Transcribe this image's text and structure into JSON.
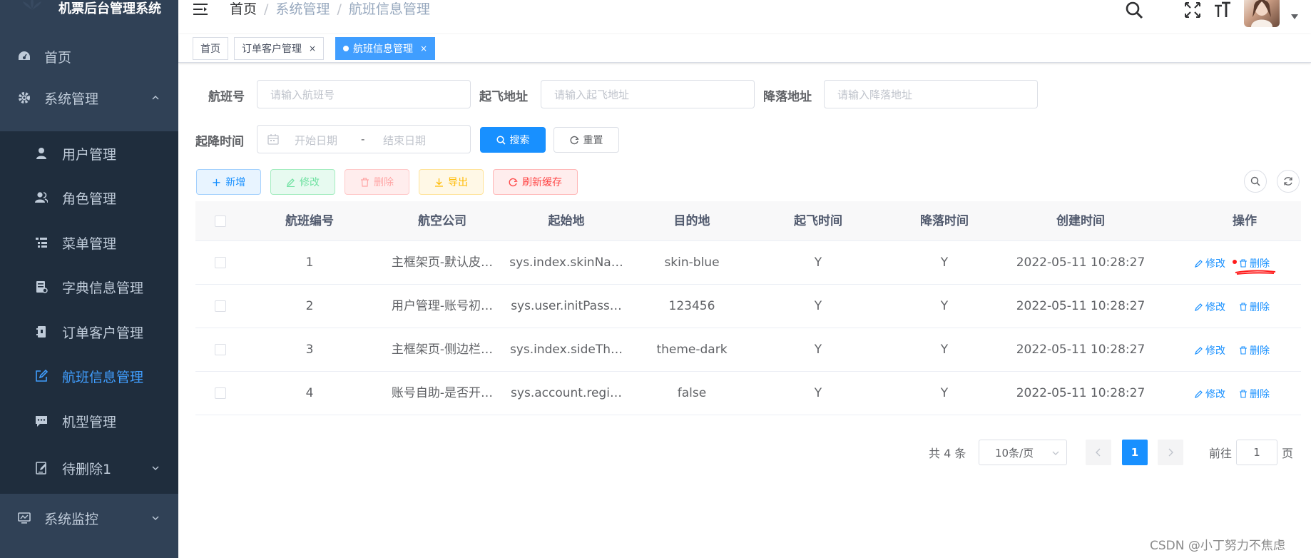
{
  "app": {
    "title": "机票后台管理系统"
  },
  "sidebar": {
    "items": [
      {
        "label": "首页",
        "icon": "dashboard-icon"
      },
      {
        "label": "系统管理",
        "icon": "gear-icon"
      },
      {
        "label": "用户管理",
        "icon": "user-icon"
      },
      {
        "label": "角色管理",
        "icon": "peoples-icon"
      },
      {
        "label": "菜单管理",
        "icon": "tree-table-icon"
      },
      {
        "label": "字典信息管理",
        "icon": "dict-icon"
      },
      {
        "label": "订单客户管理",
        "icon": "order-icon"
      },
      {
        "label": "航班信息管理",
        "icon": "edit-icon"
      },
      {
        "label": "机型管理",
        "icon": "message-icon"
      },
      {
        "label": "待删除1",
        "icon": "form-icon"
      },
      {
        "label": "系统监控",
        "icon": "monitor-icon"
      }
    ]
  },
  "navbar": {
    "breadcrumb": [
      "首页",
      "/",
      "系统管理",
      "/",
      "航班信息管理"
    ]
  },
  "tags": [
    {
      "label": "首页"
    },
    {
      "label": "订单客户管理",
      "close": "×"
    },
    {
      "label": "航班信息管理",
      "close": "×"
    }
  ],
  "search": {
    "flight_no_label": "航班号",
    "flight_no_placeholder": "请输入航班号",
    "depart_label": "起飞地址",
    "depart_placeholder": "请输入起飞地址",
    "arrive_label": "降落地址",
    "arrive_placeholder": "请输入降落地址",
    "time_label": "起降时间",
    "start_date_placeholder": "开始日期",
    "range_separator": "-",
    "end_date_placeholder": "结束日期",
    "search_button": "搜索",
    "reset_button": "重置"
  },
  "toolbar": {
    "add": "新增",
    "edit": "修改",
    "delete": "删除",
    "export": "导出",
    "refresh_cache": "刷新缓存"
  },
  "table": {
    "headers": [
      "航班编号",
      "航空公司",
      "起始地",
      "目的地",
      "起飞时间",
      "降落时间",
      "创建时间",
      "操作"
    ],
    "rows": [
      [
        "1",
        "主框架页-默认皮…",
        "sys.index.skinNa…",
        "skin-blue",
        "Y",
        "Y",
        "2022-05-11 10:28:27"
      ],
      [
        "2",
        "用户管理-账号初…",
        "sys.user.initPass…",
        "123456",
        "Y",
        "Y",
        "2022-05-11 10:28:27"
      ],
      [
        "3",
        "主框架页-侧边栏…",
        "sys.index.sideTh…",
        "theme-dark",
        "Y",
        "Y",
        "2022-05-11 10:28:27"
      ],
      [
        "4",
        "账号自助-是否开…",
        "sys.account.regi…",
        "false",
        "Y",
        "Y",
        "2022-05-11 10:28:27"
      ]
    ],
    "row_edit": "修改",
    "row_delete": "删除"
  },
  "pagination": {
    "total": "共 4 条",
    "page_size": "10条/页",
    "current_page": "1",
    "goto_prefix": "前往",
    "goto_value": "1",
    "goto_suffix": "页"
  },
  "watermark": "CSDN @小丁努力不焦虑",
  "colors": {
    "sidebar_bg": "#304156",
    "submenu_bg": "#1f2d3d",
    "accent": "#1890ff",
    "annotation": "#ff1b1b"
  }
}
